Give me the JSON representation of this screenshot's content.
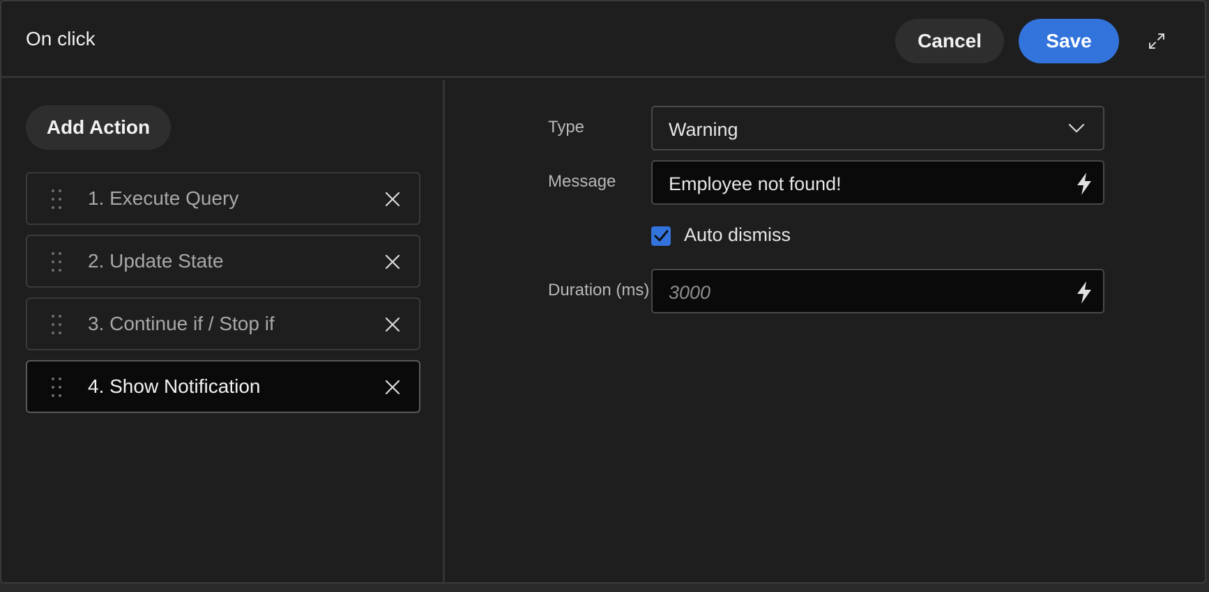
{
  "header": {
    "title": "On click",
    "cancel_label": "Cancel",
    "save_label": "Save",
    "expand_icon": "expand-icon"
  },
  "colors": {
    "accent": "#3273dc",
    "background": "#1e1e1e"
  },
  "sidebar": {
    "add_action_label": "Add Action",
    "actions": [
      {
        "label": "1. Execute Query",
        "selected": false
      },
      {
        "label": "2. Update State",
        "selected": false
      },
      {
        "label": "3. Continue if / Stop if",
        "selected": false
      },
      {
        "label": "4. Show Notification",
        "selected": true
      }
    ]
  },
  "form": {
    "type": {
      "label": "Type",
      "value": "Warning"
    },
    "message": {
      "label": "Message",
      "value": "Employee not found!"
    },
    "auto_dismiss": {
      "label": "Auto dismiss",
      "checked": true
    },
    "duration": {
      "label": "Duration (ms)",
      "placeholder": "3000"
    }
  }
}
